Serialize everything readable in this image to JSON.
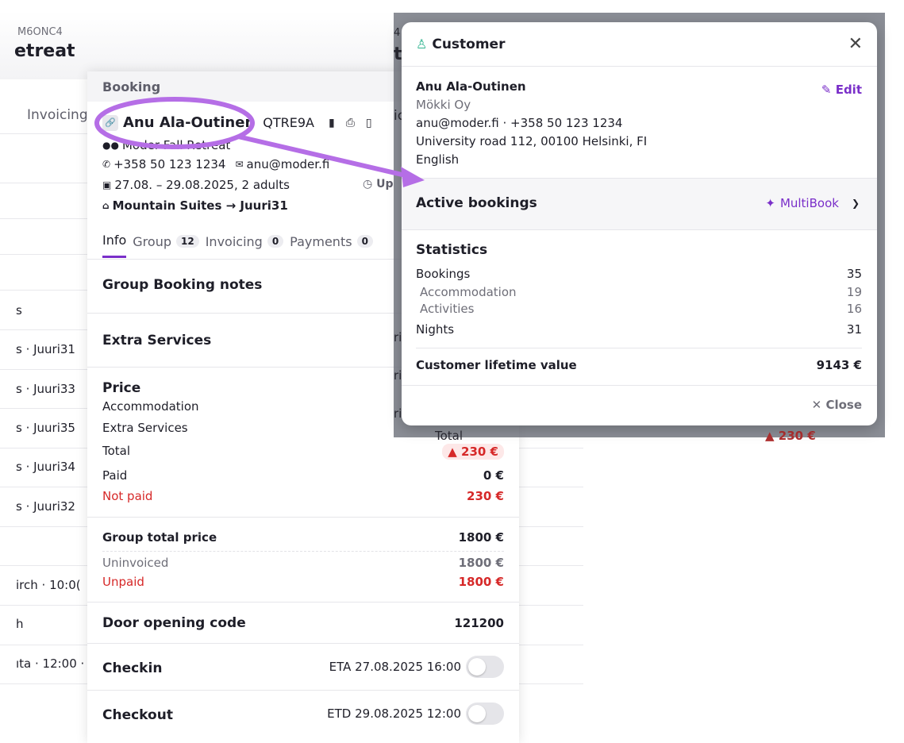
{
  "background": {
    "code": "M6ONC4",
    "title": "etreat",
    "tab_invoicing": "Invoicing",
    "rows": [
      "s",
      "s · Juuri31",
      "s · Juuri33",
      "s · Juuri35",
      "s · Juuri34",
      "s · Juuri32",
      "irch · 10:0(",
      "h",
      "ıta · 12:00 ·"
    ]
  },
  "booking": {
    "label": "Booking",
    "guest_name": "Anu Ala-Outinen",
    "booking_code": "QTRE9A",
    "event": "Moder Fall Retreat",
    "phone": "+358 50 123 1234",
    "email": "anu@moder.fi",
    "dates": "27.08. – 29.08.2025, 2 adults",
    "update_chip": "Up",
    "room": "Mountain Suites → Juuri31",
    "tabs": [
      {
        "label": "Info",
        "count": ""
      },
      {
        "label": "Group",
        "count": "12"
      },
      {
        "label": "Invoicing",
        "count": "0"
      },
      {
        "label": "Payments",
        "count": "0"
      }
    ],
    "group_notes_title": "Group Booking notes",
    "extra_services_title": "Extra Services",
    "price": {
      "title": "Price",
      "accommodation_label": "Accommodation",
      "extra_label": "Extra Services",
      "total_label": "Total",
      "total_value": "230 €",
      "paid_label": "Paid",
      "paid_value": "0 €",
      "not_paid_label": "Not paid",
      "not_paid_value": "230 €"
    },
    "group_total": {
      "label": "Group total price",
      "value": "1800 €",
      "uninvoiced_label": "Uninvoiced",
      "uninvoiced_value": "1800 €",
      "unpaid_label": "Unpaid",
      "unpaid_value": "1800 €"
    },
    "door": {
      "label": "Door opening code",
      "value": "121200"
    },
    "checkin": {
      "label": "Checkin",
      "value": "ETA 27.08.2025 16:00"
    },
    "checkout": {
      "label": "Checkout",
      "value": "ETD 29.08.2025 12:00"
    }
  },
  "overlay": {
    "partial_1": "4",
    "partial_2": "t",
    "partial_3": "ic",
    "partial_ri1": "ri",
    "partial_ri2": "ri",
    "partial_ri3": "ri",
    "total_label": "Total",
    "total_value": "230 €"
  },
  "customer": {
    "title": "Customer",
    "name": "Anu Ala-Outinen",
    "company": "Mökki Oy",
    "contact": "anu@moder.fi · +358 50 123 1234",
    "address": "University road 112, 00100 Helsinki, FI",
    "language": "English",
    "edit_label": "Edit",
    "active_bookings_title": "Active bookings",
    "multibook_label": "MultiBook",
    "statistics_title": "Statistics",
    "stats": {
      "bookings_label": "Bookings",
      "bookings_value": "35",
      "accommodation_label": "Accommodation",
      "accommodation_value": "19",
      "activities_label": "Activities",
      "activities_value": "16",
      "nights_label": "Nights",
      "nights_value": "31",
      "ltv_label": "Customer lifetime value",
      "ltv_value": "9143 €"
    },
    "close_label": "Close"
  },
  "colors": {
    "accent": "#7a2fc9",
    "danger": "#d62828",
    "success": "#2fb38f"
  }
}
